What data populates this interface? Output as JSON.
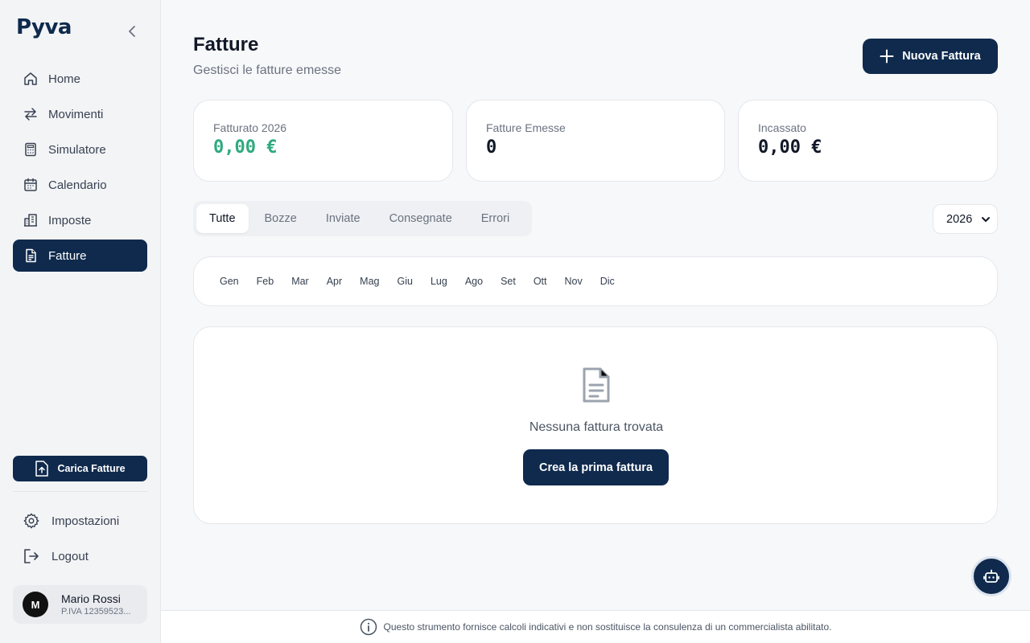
{
  "brand": {
    "name": "Pyva"
  },
  "sidebar": {
    "items": [
      {
        "label": "Home",
        "icon": "home-icon"
      },
      {
        "label": "Movimenti",
        "icon": "arrows-icon"
      },
      {
        "label": "Simulatore",
        "icon": "calculator-icon"
      },
      {
        "label": "Calendario",
        "icon": "calendar-icon"
      },
      {
        "label": "Imposte",
        "icon": "building-icon"
      },
      {
        "label": "Fatture",
        "icon": "document-icon",
        "active": true
      }
    ],
    "upload_label": "Carica Fatture",
    "settings_label": "Impostazioni",
    "logout_label": "Logout",
    "user": {
      "initial": "M",
      "name": "Mario Rossi",
      "vat": "P.IVA 12359523..."
    }
  },
  "header": {
    "title": "Fatture",
    "subtitle": "Gestisci le fatture emesse",
    "new_button": "Nuova Fattura"
  },
  "stats": [
    {
      "label": "Fatturato 2026",
      "value": "0,00 €",
      "color": "#2faa7f"
    },
    {
      "label": "Fatture Emesse",
      "value": "0"
    },
    {
      "label": "Incassato",
      "value": "0,00 €"
    }
  ],
  "tabs": [
    {
      "label": "Tutte",
      "active": true
    },
    {
      "label": "Bozze"
    },
    {
      "label": "Inviate"
    },
    {
      "label": "Consegnate"
    },
    {
      "label": "Errori"
    }
  ],
  "year_select": {
    "value": "2026"
  },
  "months": [
    "Gen",
    "Feb",
    "Mar",
    "Apr",
    "Mag",
    "Giu",
    "Lug",
    "Ago",
    "Set",
    "Ott",
    "Nov",
    "Dic"
  ],
  "empty_state": {
    "message": "Nessuna fattura trovata",
    "button": "Crea la prima fattura"
  },
  "footer": {
    "disclaimer": "Questo strumento fornisce calcoli indicativi e non sostituisce la consulenza di un commercialista abilitato."
  },
  "colors": {
    "primary": "#0f2a4d",
    "accent_green": "#2faa7f"
  }
}
